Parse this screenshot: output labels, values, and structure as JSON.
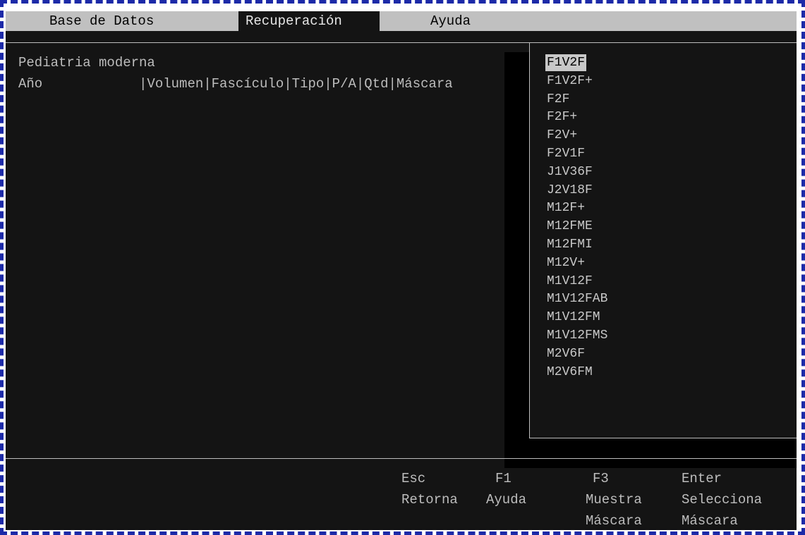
{
  "menubar": {
    "items": [
      {
        "label": "Base de Datos"
      },
      {
        "label": "Recuperación"
      },
      {
        "label": "Ayuda"
      }
    ]
  },
  "main": {
    "title": "Pediatria moderna",
    "columns_header": "Año            |Volumen|Fascículo|Tipo|P/A|Qtd|Máscara"
  },
  "popup": {
    "selected_index": 0,
    "options": [
      "F1V2F",
      "F1V2F+",
      "F2F",
      "F2F+",
      "F2V+",
      "F2V1F",
      "J1V36F",
      "J2V18F",
      "M12F+",
      "M12FME",
      "M12FMI",
      "M12V+",
      "M1V12F",
      "M1V12FAB",
      "M1V12FM",
      "M1V12FMS",
      "M2V6F",
      "M2V6FM"
    ]
  },
  "footer": {
    "keys": [
      {
        "key": "Esc",
        "line1": "Retorna",
        "line2": ""
      },
      {
        "key": "F1",
        "line1": "Ayuda",
        "line2": ""
      },
      {
        "key": "F3",
        "line1": "Muestra",
        "line2": "Máscara"
      },
      {
        "key": "Enter",
        "line1": "Selecciona",
        "line2": "Máscara"
      }
    ]
  },
  "colors": {
    "frame": "#1c2aa8",
    "screen_bg": "#141414",
    "menubar_bg": "#c0c0c0",
    "text": "#bdbdbd"
  }
}
